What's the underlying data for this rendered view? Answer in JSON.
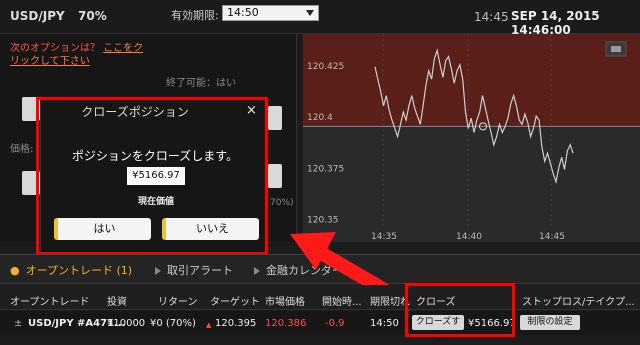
{
  "header": {
    "pair": "USD/JPY",
    "percent": "70%",
    "expiry_label": "有効期限:",
    "expiry_value": "14:50",
    "time_short": "14:45",
    "datetime": "SEP 14, 2015 14:46:00"
  },
  "left_panel": {
    "next_option_text": "次のオプションは？",
    "next_option_link": "ここをクリックして下さい",
    "end_available": "終了可能：はい",
    "price_label": "価格:",
    "pct_partial": "70%)"
  },
  "chart_data": {
    "type": "line",
    "x_ticks": [
      "14:35",
      "14:40",
      "14:45"
    ],
    "y_ticks": [
      "120.425",
      "120.4",
      "120.375",
      "120.35"
    ],
    "ylim": [
      120.345,
      120.44
    ],
    "target": 120.395,
    "colors": {
      "above": "#5a1f18",
      "below": "#2a2a2a",
      "line": "#cfcfcf"
    },
    "values": [
      120.424,
      120.418,
      120.412,
      120.405,
      120.41,
      120.403,
      120.398,
      120.394,
      120.39,
      120.396,
      120.402,
      120.398,
      120.405,
      120.41,
      120.404,
      120.4,
      120.396,
      120.405,
      120.415,
      120.422,
      120.418,
      120.428,
      120.432,
      120.425,
      120.419,
      120.427,
      120.429,
      120.423,
      120.416,
      120.422,
      120.425,
      120.418,
      120.402,
      120.394,
      120.399,
      120.392,
      120.398,
      120.402,
      120.41,
      120.404,
      120.398,
      120.392,
      120.386,
      120.39,
      120.396,
      120.392,
      120.395,
      120.399,
      120.406,
      120.41,
      120.405,
      120.398,
      120.396,
      120.401,
      120.397,
      120.39,
      120.394,
      120.4,
      120.398,
      120.385,
      120.378,
      120.382,
      120.377,
      120.372,
      120.368,
      120.375,
      120.38,
      120.374,
      120.383,
      120.386,
      120.382
    ]
  },
  "modal": {
    "title": "クローズポジション",
    "close_icon": "×",
    "message": "ポジションをクローズします。",
    "amount": "¥5166.97",
    "amount_label": "現在価値",
    "yes": "はい",
    "no": "いいえ"
  },
  "tabs": {
    "open_trades": "オープントレード (1)",
    "trade_alerts": "取引アラート",
    "econ_calendar": "金融カレンダー"
  },
  "table": {
    "headers": [
      "オープントレード",
      "投資",
      "リターン",
      "ターゲット",
      "市場価格",
      "開始時...",
      "期限切れ",
      "クローズ",
      "ストップロス/テイクプ..."
    ],
    "row": {
      "asset": "USD/JPY #A471...",
      "invest": "¥10000",
      "return": "¥0 (70%)",
      "target": "120.395",
      "market": "120.386",
      "change": "-0.9",
      "expiry": "14:50",
      "close_btn": "クローズする",
      "close_value": "¥5166.97",
      "limit_btn": "制限の設定"
    }
  }
}
